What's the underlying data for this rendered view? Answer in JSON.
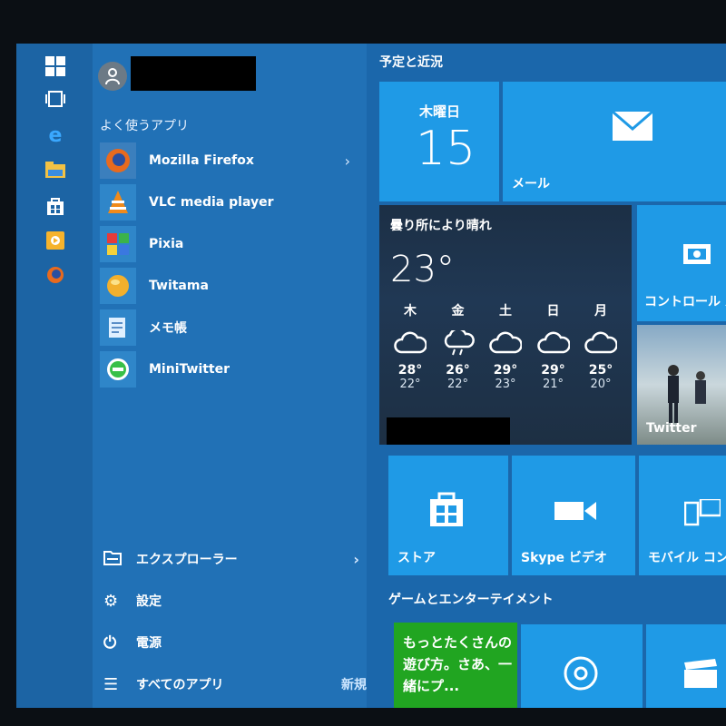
{
  "user": {
    "name_redacted": true
  },
  "left_menu": {
    "section_title": "よく使うアプリ",
    "apps": [
      {
        "label": "Mozilla Firefox",
        "icon": "firefox-icon"
      },
      {
        "label": "VLC media player",
        "icon": "vlc-icon"
      },
      {
        "label": "Pixia",
        "icon": "pixia-icon"
      },
      {
        "label": "Twitama",
        "icon": "twitama-icon"
      },
      {
        "label": "メモ帳",
        "icon": "notepad-icon"
      },
      {
        "label": "MiniTwitter",
        "icon": "minitwitter-icon"
      }
    ],
    "bottom": [
      {
        "label": "エクスプローラー",
        "icon": "folder-icon"
      },
      {
        "label": "設定",
        "icon": "gear-icon"
      },
      {
        "label": "電源",
        "icon": "power-icon"
      },
      {
        "label": "すべてのアプリ",
        "icon": "list-icon",
        "badge": "新規"
      }
    ]
  },
  "rail": {
    "icons": [
      "windows-icon",
      "task-view-icon",
      "edge-icon",
      "file-explorer-icon",
      "store-icon",
      "media-icon",
      "firefox-icon"
    ]
  },
  "tiles": {
    "group1_title": "予定と近況",
    "date_tile": {
      "day": "木曜日",
      "date": "15"
    },
    "mail_tile": {
      "label": "メール"
    },
    "weather_tile": {
      "condition": "曇り所により晴れ",
      "temp": "23°",
      "forecast": [
        {
          "day": "木",
          "hi": "28°",
          "lo": "22°"
        },
        {
          "day": "金",
          "hi": "26°",
          "lo": "22°"
        },
        {
          "day": "土",
          "hi": "29°",
          "lo": "23°"
        },
        {
          "day": "日",
          "hi": "29°",
          "lo": "21°"
        },
        {
          "day": "月",
          "hi": "25°",
          "lo": "20°"
        }
      ]
    },
    "control_panel_tile": {
      "label": "コントロール パ"
    },
    "twitter_tile": {
      "label": "Twitter"
    },
    "store_tile": {
      "label": "ストア"
    },
    "skype_tile": {
      "label": "Skype ビデオ"
    },
    "mobile_tile": {
      "label": "モバイル コン"
    },
    "group2_title": "ゲームとエンターテイメント",
    "game_tile": {
      "text": "もっとたくさんの遊び方。さあ、一緒にプ..."
    },
    "groove_tile": {},
    "movies_tile": {}
  },
  "colors": {
    "background_frame": "#0b0f14",
    "menu_blue": "#2171b6",
    "rail_blue": "#1c64a4",
    "tile_blue": "#1f9ae6",
    "weather_dark": "#1f344d",
    "green_tile": "#21a521"
  }
}
